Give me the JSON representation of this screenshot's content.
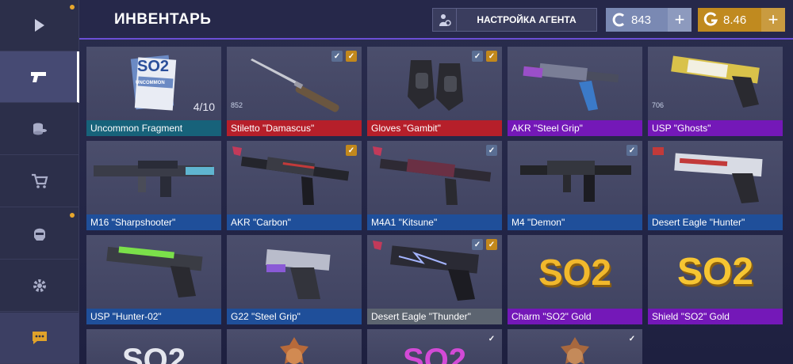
{
  "header": {
    "title": "ИНВЕНТАРЬ",
    "agent_button": "НАСТРОЙКА АГЕНТА",
    "silver_amount": "843",
    "gold_amount": "8.46",
    "silver_color": "#7a89b3",
    "gold_color": "#c08a1f"
  },
  "sidebar": {
    "items": [
      {
        "icon": "play-icon"
      },
      {
        "icon": "pistol-icon",
        "active": true
      },
      {
        "icon": "coins-icon"
      },
      {
        "icon": "cart-icon"
      },
      {
        "icon": "helmet-icon"
      },
      {
        "icon": "gear-icon"
      },
      {
        "icon": "chat-icon"
      }
    ]
  },
  "inventory": {
    "items": [
      {
        "name": "Uncommon Fragment",
        "rarity": "blue",
        "count": "4/10"
      },
      {
        "name": "Stiletto \"Damascus\"",
        "rarity": "red",
        "badge": "852"
      },
      {
        "name": "Gloves \"Gambit\"",
        "rarity": "red"
      },
      {
        "name": "AKR \"Steel Grip\"",
        "rarity": "purple"
      },
      {
        "name": "USP \"Ghosts\"",
        "rarity": "purple",
        "badge": "706"
      },
      {
        "name": "M16 \"Sharpshooter\"",
        "rarity": "blue"
      },
      {
        "name": "AKR \"Carbon\"",
        "rarity": "blue"
      },
      {
        "name": "M4A1 \"Kitsune\"",
        "rarity": "blue"
      },
      {
        "name": "M4 \"Demon\"",
        "rarity": "blue"
      },
      {
        "name": "Desert Eagle \"Hunter\"",
        "rarity": "blue"
      },
      {
        "name": "USP \"Hunter-02\"",
        "rarity": "blue"
      },
      {
        "name": "G22 \"Steel Grip\"",
        "rarity": "blue"
      },
      {
        "name": "Desert Eagle \"Thunder\"",
        "rarity": "gray"
      },
      {
        "name": "Charm \"SO2\" Gold",
        "rarity": "purple"
      },
      {
        "name": "Shield \"SO2\" Gold",
        "rarity": "purple"
      }
    ],
    "fragment_label": "SO2",
    "fragment_sublabel": "UNCOMMON",
    "logo_text": "SO2"
  }
}
